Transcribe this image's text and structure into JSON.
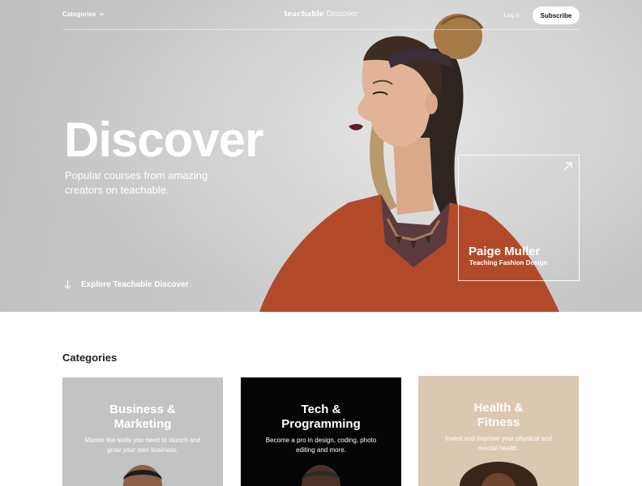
{
  "nav": {
    "categories_label": "Categories",
    "logo_brand": "teachable",
    "logo_suffix": "Discover",
    "login_label": "Log in",
    "subscribe_label": "Subscribe"
  },
  "hero": {
    "title": "Discover",
    "subtitle": "Popular courses from amazing creators on teachable.",
    "explore_label": "Explore Teachable Discover",
    "featured": {
      "name": "Paige Muller",
      "role": "Teaching Fashion Design"
    }
  },
  "categories": {
    "heading": "Categories",
    "items": [
      {
        "title_line1": "Business &",
        "title_line2": "Marketing",
        "description": "Master the skills you need to launch and grow your own business.",
        "background": "#c3c3c3"
      },
      {
        "title_line1": "Tech &",
        "title_line2": "Programming",
        "description": "Become a pro in design, coding, photo editing and more.",
        "background": "#050505"
      },
      {
        "title_line1": "Health &",
        "title_line2": "Fitness",
        "description": "Invest and improve your physical and mental health.",
        "background": "#dcc8b1"
      }
    ]
  },
  "colors": {
    "hero_bg": "#d2d2d2",
    "text_dark": "#222222",
    "white": "#ffffff"
  },
  "icons": [
    "chevron-down-icon",
    "arrow-down-icon",
    "arrow-up-right-icon"
  ]
}
